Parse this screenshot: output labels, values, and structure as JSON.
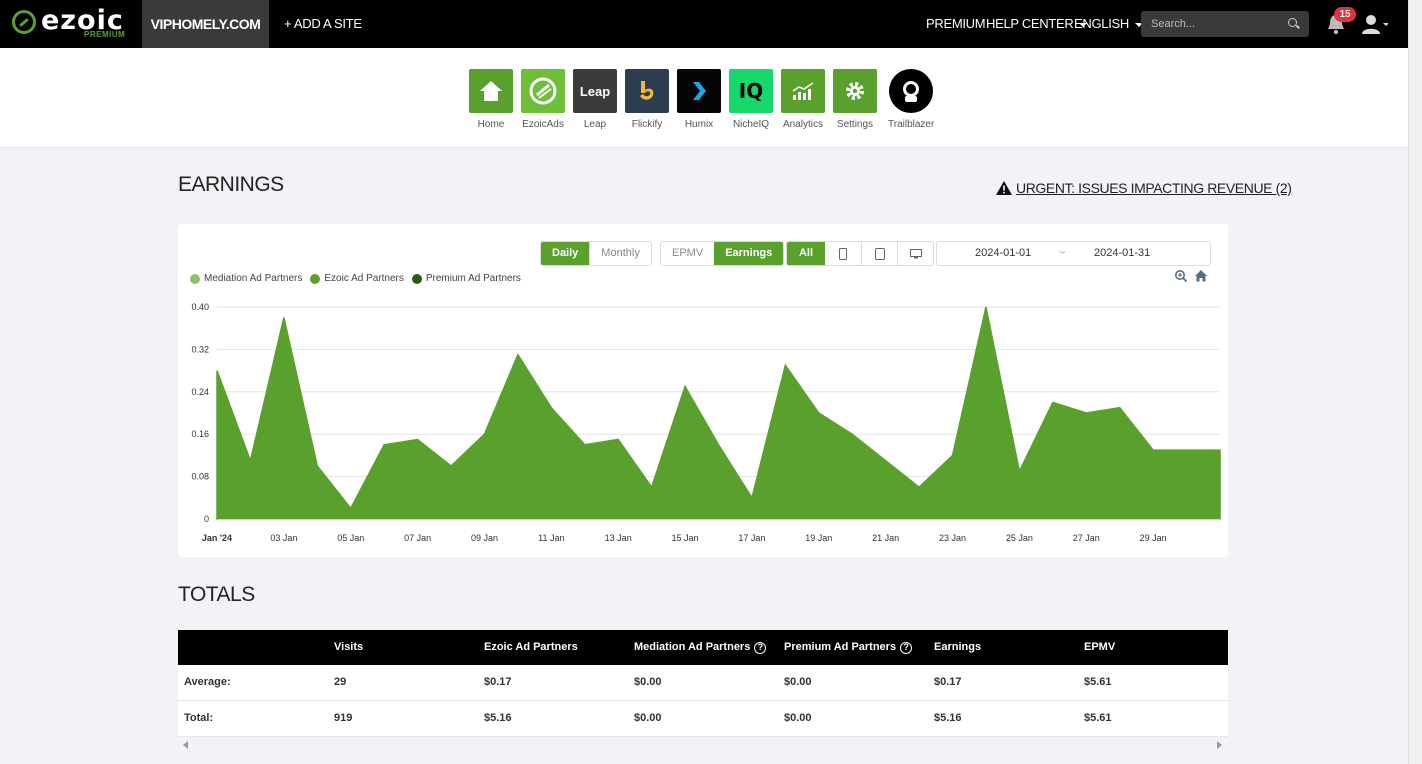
{
  "header": {
    "logo_text": "ezoic",
    "logo_sub": "PREMIUM",
    "site": "VIPHOMELY.COM",
    "add_site": "+ ADD A SITE",
    "premium": "PREMIUM",
    "help_center": "HELP CENTER",
    "language": "ENGLISH",
    "search_placeholder": "Search...",
    "notification_count": "15"
  },
  "apps": [
    {
      "label": "Home",
      "icon": "home-icon",
      "color": "#5aa02c"
    },
    {
      "label": "EzoicAds",
      "icon": "ezoicads-icon",
      "color": "#6cbf36"
    },
    {
      "label": "Leap",
      "icon": "leap-icon",
      "color": "#3b3b3b",
      "text": "Leap"
    },
    {
      "label": "Flickify",
      "icon": "flickify-icon",
      "color": "#2c3e50"
    },
    {
      "label": "Humix",
      "icon": "humix-icon",
      "color": "#050505"
    },
    {
      "label": "NicheIQ",
      "icon": "nicheiq-icon",
      "color": "#17d86a",
      "text": "IQ"
    },
    {
      "label": "Analytics",
      "icon": "analytics-icon",
      "color": "#5aa02c"
    },
    {
      "label": "Settings",
      "icon": "gear-icon",
      "color": "#5aa02c"
    },
    {
      "label": "Trailblazer",
      "icon": "trailblazer-icon",
      "color": "#000000"
    }
  ],
  "earnings": {
    "title": "EARNINGS",
    "urgent": "URGENT: ISSUES IMPACTING REVENUE (2)",
    "period_buttons": [
      "Daily",
      "Monthly"
    ],
    "metric_buttons": [
      "EPMV",
      "Earnings"
    ],
    "device_all": "All",
    "date_start": "2024-01-01",
    "date_sep": "~",
    "date_end": "2024-01-31"
  },
  "chart_data": {
    "type": "area",
    "legend": [
      "Mediation Ad Partners",
      "Ezoic Ad Partners",
      "Premium Ad Partners"
    ],
    "legend_colors": [
      "#8dc26b",
      "#5aa02c",
      "#2e5a14"
    ],
    "fill_color": "#5aa02c",
    "x": [
      "Jan '24",
      "02 Jan",
      "03 Jan",
      "04 Jan",
      "05 Jan",
      "06 Jan",
      "07 Jan",
      "08 Jan",
      "09 Jan",
      "10 Jan",
      "11 Jan",
      "12 Jan",
      "13 Jan",
      "14 Jan",
      "15 Jan",
      "16 Jan",
      "17 Jan",
      "18 Jan",
      "19 Jan",
      "20 Jan",
      "21 Jan",
      "22 Jan",
      "23 Jan",
      "24 Jan",
      "25 Jan",
      "26 Jan",
      "27 Jan",
      "28 Jan",
      "29 Jan",
      "30 Jan",
      "31 Jan"
    ],
    "x_tick_labels": [
      "Jan '24",
      "03 Jan",
      "05 Jan",
      "07 Jan",
      "09 Jan",
      "11 Jan",
      "13 Jan",
      "15 Jan",
      "17 Jan",
      "19 Jan",
      "21 Jan",
      "23 Jan",
      "25 Jan",
      "27 Jan",
      "29 Jan"
    ],
    "series": [
      {
        "name": "Ezoic Ad Partners",
        "values": [
          0.28,
          0.11,
          0.38,
          0.1,
          0.02,
          0.14,
          0.15,
          0.1,
          0.16,
          0.31,
          0.21,
          0.14,
          0.15,
          0.06,
          0.25,
          0.14,
          0.04,
          0.29,
          0.2,
          0.16,
          0.11,
          0.06,
          0.12,
          0.4,
          0.09,
          0.22,
          0.2,
          0.21,
          0.13,
          0.13,
          0.13
        ]
      }
    ],
    "y_ticks": [
      "0",
      "0.08",
      "0.16",
      "0.24",
      "0.32",
      "0.40"
    ],
    "ylim": [
      0,
      0.4
    ]
  },
  "totals": {
    "title": "TOTALS",
    "columns": [
      "",
      "Visits",
      "Ezoic Ad Partners",
      "Mediation Ad Partners",
      "Premium Ad Partners",
      "Earnings",
      "EPMV"
    ],
    "rows": [
      [
        "Average:",
        "29",
        "$0.17",
        "$0.00",
        "$0.00",
        "$0.17",
        "$5.61"
      ],
      [
        "Total:",
        "919",
        "$5.16",
        "$0.00",
        "$0.00",
        "$5.16",
        "$5.61"
      ]
    ]
  }
}
